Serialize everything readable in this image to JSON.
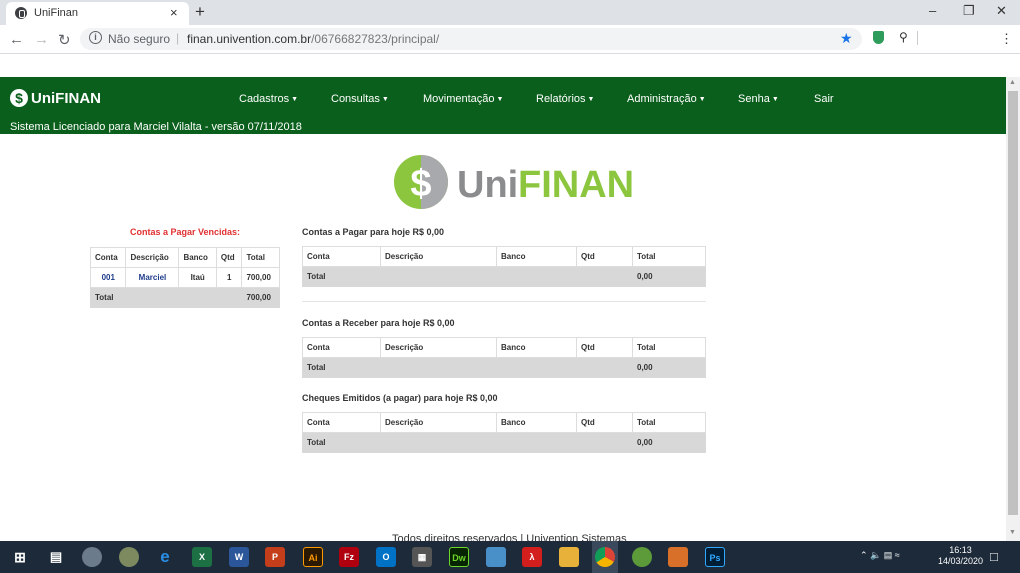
{
  "browser": {
    "tab_title": "UniFinan",
    "tab_close": "×",
    "new_tab": "+",
    "security_label": "Não seguro",
    "url_host": "finan.univention.com.br",
    "url_path": "/06766827823/principal/"
  },
  "header": {
    "logo_text": "UniFINAN",
    "menu": [
      "Cadastros",
      "Consultas",
      "Movimentação",
      "Relatórios",
      "Administração",
      "Senha",
      "Sair"
    ],
    "license": "Sistema Licenciado para Marciel Vilalta - versão 07/11/2018"
  },
  "colors": {
    "header_bg": "#0a5f1c",
    "overdue_title": "#e03030",
    "logo_green": "#8cc63f",
    "logo_gray": "#a7a9ac"
  },
  "overdue": {
    "title": "Contas a Pagar Vencidas:",
    "columns": [
      "Conta",
      "Descrição",
      "Banco",
      "Qtd",
      "Total"
    ],
    "rows": [
      {
        "conta": "001",
        "descricao": "Marciel",
        "banco": "Itaú",
        "qtd": "1",
        "total": "700,00"
      }
    ],
    "total_label": "Total",
    "total_value": "700,00"
  },
  "sections": [
    {
      "title": "Contas a Pagar para hoje R$ 0,00",
      "columns": [
        "Conta",
        "Descrição",
        "Banco",
        "Qtd",
        "Total"
      ],
      "total_label": "Total",
      "total_value": "0,00"
    },
    {
      "title": "Contas a Receber para hoje R$ 0,00",
      "columns": [
        "Conta",
        "Descrição",
        "Banco",
        "Qtd",
        "Total"
      ],
      "total_label": "Total",
      "total_value": "0,00"
    },
    {
      "title": "Cheques Emitidos (a pagar) para hoje R$ 0,00",
      "columns": [
        "Conta",
        "Descrição",
        "Banco",
        "Qtd",
        "Total"
      ],
      "total_label": "Total",
      "total_value": "0,00"
    }
  ],
  "footer": "Todos direitos reservados | Univention Sistemas",
  "taskbar": {
    "time": "16:13",
    "date": "14/03/2020"
  }
}
